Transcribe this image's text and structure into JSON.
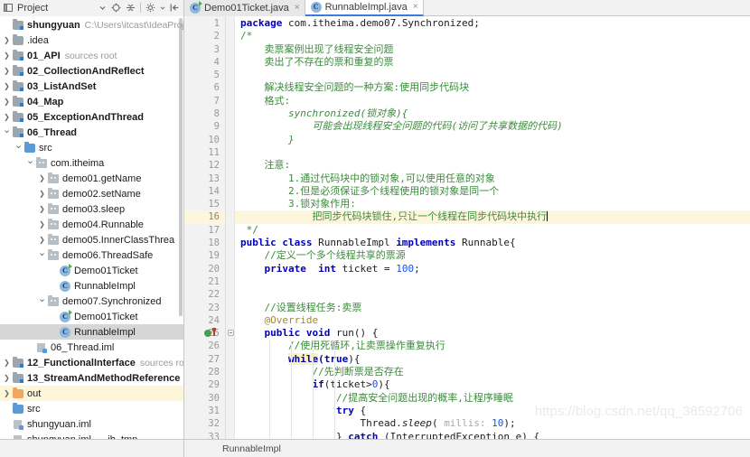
{
  "toolwindow": {
    "title": "Project",
    "icons": [
      "chevron-down-icon",
      "locate-target-icon",
      "collapse-all-icon",
      "settings-gear-icon",
      "hide-window-icon"
    ]
  },
  "tabs": [
    {
      "label": "Demo01Ticket.java",
      "icon": "java-class-runnable-icon",
      "active": false,
      "close": "×"
    },
    {
      "label": "RunnableImpl.java",
      "icon": "java-class-icon",
      "active": true,
      "close": "×"
    }
  ],
  "tree": [
    {
      "depth": 0,
      "twisty": "",
      "icon": "module-folder-icon",
      "label": "shungyuan",
      "bold": true,
      "sub": "C:\\Users\\itcast\\IdeaProjec",
      "state": "normal"
    },
    {
      "depth": 0,
      "twisty": "›",
      "icon": "folder-gray-icon",
      "label": ".idea",
      "bold": false,
      "sub": "",
      "state": "normal"
    },
    {
      "depth": 0,
      "twisty": "›",
      "icon": "module-folder-icon",
      "label": "01_API",
      "bold": true,
      "sub": "sources root",
      "state": "normal"
    },
    {
      "depth": 0,
      "twisty": "›",
      "icon": "module-folder-icon",
      "label": "02_CollectionAndReflect",
      "bold": true,
      "sub": "",
      "state": "normal"
    },
    {
      "depth": 0,
      "twisty": "›",
      "icon": "module-folder-icon",
      "label": "03_ListAndSet",
      "bold": true,
      "sub": "",
      "state": "normal"
    },
    {
      "depth": 0,
      "twisty": "›",
      "icon": "module-folder-icon",
      "label": "04_Map",
      "bold": true,
      "sub": "",
      "state": "normal"
    },
    {
      "depth": 0,
      "twisty": "›",
      "icon": "module-folder-icon",
      "label": "05_ExceptionAndThread",
      "bold": true,
      "sub": "",
      "state": "normal"
    },
    {
      "depth": 0,
      "twisty": "⌄",
      "icon": "module-folder-icon",
      "label": "06_Thread",
      "bold": true,
      "sub": "",
      "state": "normal"
    },
    {
      "depth": 1,
      "twisty": "⌄",
      "icon": "folder-blue-icon",
      "label": "src",
      "bold": false,
      "sub": "",
      "state": "normal"
    },
    {
      "depth": 2,
      "twisty": "⌄",
      "icon": "package-icon",
      "label": "com.itheima",
      "bold": false,
      "sub": "",
      "state": "normal"
    },
    {
      "depth": 3,
      "twisty": "›",
      "icon": "package-icon",
      "label": "demo01.getName",
      "bold": false,
      "sub": "",
      "state": "normal"
    },
    {
      "depth": 3,
      "twisty": "›",
      "icon": "package-icon",
      "label": "demo02.setName",
      "bold": false,
      "sub": "",
      "state": "normal"
    },
    {
      "depth": 3,
      "twisty": "›",
      "icon": "package-icon",
      "label": "demo03.sleep",
      "bold": false,
      "sub": "",
      "state": "normal"
    },
    {
      "depth": 3,
      "twisty": "›",
      "icon": "package-icon",
      "label": "demo04.Runnable",
      "bold": false,
      "sub": "",
      "state": "normal"
    },
    {
      "depth": 3,
      "twisty": "›",
      "icon": "package-icon",
      "label": "demo05.InnerClassThrea",
      "bold": false,
      "sub": "",
      "state": "normal"
    },
    {
      "depth": 3,
      "twisty": "⌄",
      "icon": "package-icon",
      "label": "demo06.ThreadSafe",
      "bold": false,
      "sub": "",
      "state": "normal"
    },
    {
      "depth": 4,
      "twisty": "",
      "icon": "java-class-runnable-icon",
      "label": "Demo01Ticket",
      "bold": false,
      "sub": "",
      "state": "normal"
    },
    {
      "depth": 4,
      "twisty": "",
      "icon": "java-class-icon",
      "label": "RunnableImpl",
      "bold": false,
      "sub": "",
      "state": "normal"
    },
    {
      "depth": 3,
      "twisty": "⌄",
      "icon": "package-icon",
      "label": "demo07.Synchronized",
      "bold": false,
      "sub": "",
      "state": "normal"
    },
    {
      "depth": 4,
      "twisty": "",
      "icon": "java-class-runnable-icon",
      "label": "Demo01Ticket",
      "bold": false,
      "sub": "",
      "state": "normal"
    },
    {
      "depth": 4,
      "twisty": "",
      "icon": "java-class-icon",
      "label": "RunnableImpl",
      "bold": false,
      "sub": "",
      "state": "selected"
    },
    {
      "depth": 2,
      "twisty": "",
      "icon": "iml-file-icon",
      "label": "06_Thread.iml",
      "bold": false,
      "sub": "",
      "state": "normal"
    },
    {
      "depth": 0,
      "twisty": "›",
      "icon": "module-folder-icon",
      "label": "12_FunctionalInterface",
      "bold": true,
      "sub": "sources ro",
      "state": "normal"
    },
    {
      "depth": 0,
      "twisty": "›",
      "icon": "module-folder-icon",
      "label": "13_StreamAndMethodReference",
      "bold": true,
      "sub": "",
      "state": "normal"
    },
    {
      "depth": 0,
      "twisty": "›",
      "icon": "folder-orange-icon",
      "label": "out",
      "bold": false,
      "sub": "",
      "state": "excluded"
    },
    {
      "depth": 0,
      "twisty": "",
      "icon": "folder-blue-icon",
      "label": "src",
      "bold": false,
      "sub": "",
      "state": "normal"
    },
    {
      "depth": 0,
      "twisty": "",
      "icon": "iml-file-icon",
      "label": "shungyuan.iml",
      "bold": false,
      "sub": "",
      "state": "normal"
    },
    {
      "depth": 0,
      "twisty": "",
      "icon": "iml-tmp-file-icon",
      "label": "shungyuan.iml___jb_tmp__",
      "bold": false,
      "sub": "",
      "state": "normal"
    }
  ],
  "editor": {
    "first_line": 1,
    "last_line": 33,
    "current_line": 16,
    "gutter_markers": [
      {
        "line": 25,
        "icon": "run-gutter-icon"
      },
      {
        "line": 25,
        "icon": "override-method-icon"
      }
    ],
    "lines": [
      {
        "n": 1,
        "segs": [
          {
            "t": "package ",
            "c": "kw"
          },
          {
            "t": "com.itheima.demo07.Synchronized;",
            "c": "plain"
          }
        ]
      },
      {
        "n": 2,
        "segs": [
          {
            "t": "/*",
            "c": "cm"
          }
        ]
      },
      {
        "n": 3,
        "segs": [
          {
            "t": "    卖票案例出现了线程安全问题",
            "c": "cm"
          }
        ]
      },
      {
        "n": 4,
        "segs": [
          {
            "t": "    卖出了不存在的票和重复的票",
            "c": "cm"
          }
        ]
      },
      {
        "n": 5,
        "segs": [
          {
            "t": "",
            "c": "cm"
          }
        ]
      },
      {
        "n": 6,
        "segs": [
          {
            "t": "    解决线程安全问题的一种方案:使用同步代码块",
            "c": "cm"
          }
        ]
      },
      {
        "n": 7,
        "segs": [
          {
            "t": "    格式:",
            "c": "cm"
          }
        ]
      },
      {
        "n": 8,
        "segs": [
          {
            "t": "        synchronized(锁对象){",
            "c": "cmi"
          }
        ]
      },
      {
        "n": 9,
        "segs": [
          {
            "t": "            可能会出现线程安全问题的代码(访问了共享数据的代码)",
            "c": "cmi"
          }
        ]
      },
      {
        "n": 10,
        "segs": [
          {
            "t": "        }",
            "c": "cmi"
          }
        ]
      },
      {
        "n": 11,
        "segs": [
          {
            "t": "",
            "c": "cm"
          }
        ]
      },
      {
        "n": 12,
        "segs": [
          {
            "t": "    注意:",
            "c": "cm"
          }
        ]
      },
      {
        "n": 13,
        "segs": [
          {
            "t": "        1.通过代码块中的锁对象,可以使用任意的对象",
            "c": "cm"
          }
        ]
      },
      {
        "n": 14,
        "segs": [
          {
            "t": "        2.但是必须保证多个线程使用的锁对象是同一个",
            "c": "cm"
          }
        ]
      },
      {
        "n": 15,
        "segs": [
          {
            "t": "        3.锁对象作用:",
            "c": "cm"
          }
        ]
      },
      {
        "n": 16,
        "segs": [
          {
            "t": "            把同步代码块锁住,只让一个线程在同步代码块中执行",
            "c": "cm"
          }
        ],
        "caret": true,
        "current": true
      },
      {
        "n": 17,
        "segs": [
          {
            "t": " */",
            "c": "cm"
          }
        ]
      },
      {
        "n": 18,
        "segs": [
          {
            "t": "public class ",
            "c": "kw"
          },
          {
            "t": "RunnableImpl ",
            "c": "plain"
          },
          {
            "t": "implements ",
            "c": "kw"
          },
          {
            "t": "Runnable{",
            "c": "plain"
          }
        ]
      },
      {
        "n": 19,
        "segs": [
          {
            "t": "    //定义一个多个线程共享的票源",
            "c": "cm"
          }
        ]
      },
      {
        "n": 20,
        "segs": [
          {
            "t": "    private  int ",
            "c": "kw"
          },
          {
            "t": "ticket = ",
            "c": "plain"
          },
          {
            "t": "100",
            "c": "num"
          },
          {
            "t": ";",
            "c": "plain"
          }
        ]
      },
      {
        "n": 21,
        "segs": [
          {
            "t": "",
            "c": "plain"
          }
        ]
      },
      {
        "n": 22,
        "segs": [
          {
            "t": "",
            "c": "plain"
          }
        ]
      },
      {
        "n": 23,
        "segs": [
          {
            "t": "    //设置线程任务:卖票",
            "c": "cm"
          }
        ]
      },
      {
        "n": 24,
        "segs": [
          {
            "t": "    @Override",
            "c": "ann"
          }
        ]
      },
      {
        "n": 25,
        "segs": [
          {
            "t": "    public void ",
            "c": "kw"
          },
          {
            "t": "run() {",
            "c": "plain"
          }
        ]
      },
      {
        "n": 26,
        "segs": [
          {
            "t": "        //使用死循环,让卖票操作重复执行",
            "c": "cm"
          }
        ]
      },
      {
        "n": 27,
        "segs": [
          {
            "t": "        ",
            "c": "plain"
          },
          {
            "t": "while",
            "c": "hl-kw"
          },
          {
            "t": "(",
            "c": "kw"
          },
          {
            "t": "true",
            "c": "kw"
          },
          {
            "t": "){",
            "c": "plain"
          }
        ]
      },
      {
        "n": 28,
        "segs": [
          {
            "t": "            //先判断票是否存在",
            "c": "cm"
          }
        ]
      },
      {
        "n": 29,
        "segs": [
          {
            "t": "            if",
            "c": "kw"
          },
          {
            "t": "(ticket>",
            "c": "plain"
          },
          {
            "t": "0",
            "c": "num"
          },
          {
            "t": "){",
            "c": "plain"
          }
        ]
      },
      {
        "n": 30,
        "segs": [
          {
            "t": "                //提高安全问题出现的概率,让程序睡眠",
            "c": "cm"
          }
        ]
      },
      {
        "n": 31,
        "segs": [
          {
            "t": "                try ",
            "c": "kw"
          },
          {
            "t": "{",
            "c": "plain"
          }
        ]
      },
      {
        "n": 32,
        "segs": [
          {
            "t": "                    Thread.",
            "c": "plain"
          },
          {
            "t": "sleep",
            "c": "mth"
          },
          {
            "t": "( ",
            "c": "plain"
          },
          {
            "t": "millis:",
            "c": "hint"
          },
          {
            "t": " ",
            "c": "plain"
          },
          {
            "t": "10",
            "c": "num"
          },
          {
            "t": ");",
            "c": "plain"
          }
        ]
      },
      {
        "n": 33,
        "segs": [
          {
            "t": "                } ",
            "c": "plain"
          },
          {
            "t": "catch ",
            "c": "kw"
          },
          {
            "t": "(InterruptedException e) {",
            "c": "plain"
          }
        ]
      }
    ]
  },
  "statusbar": {
    "breadcrumb": "RunnableImpl",
    "watermark": "https://blog.csdn.net/qq_38592706"
  }
}
